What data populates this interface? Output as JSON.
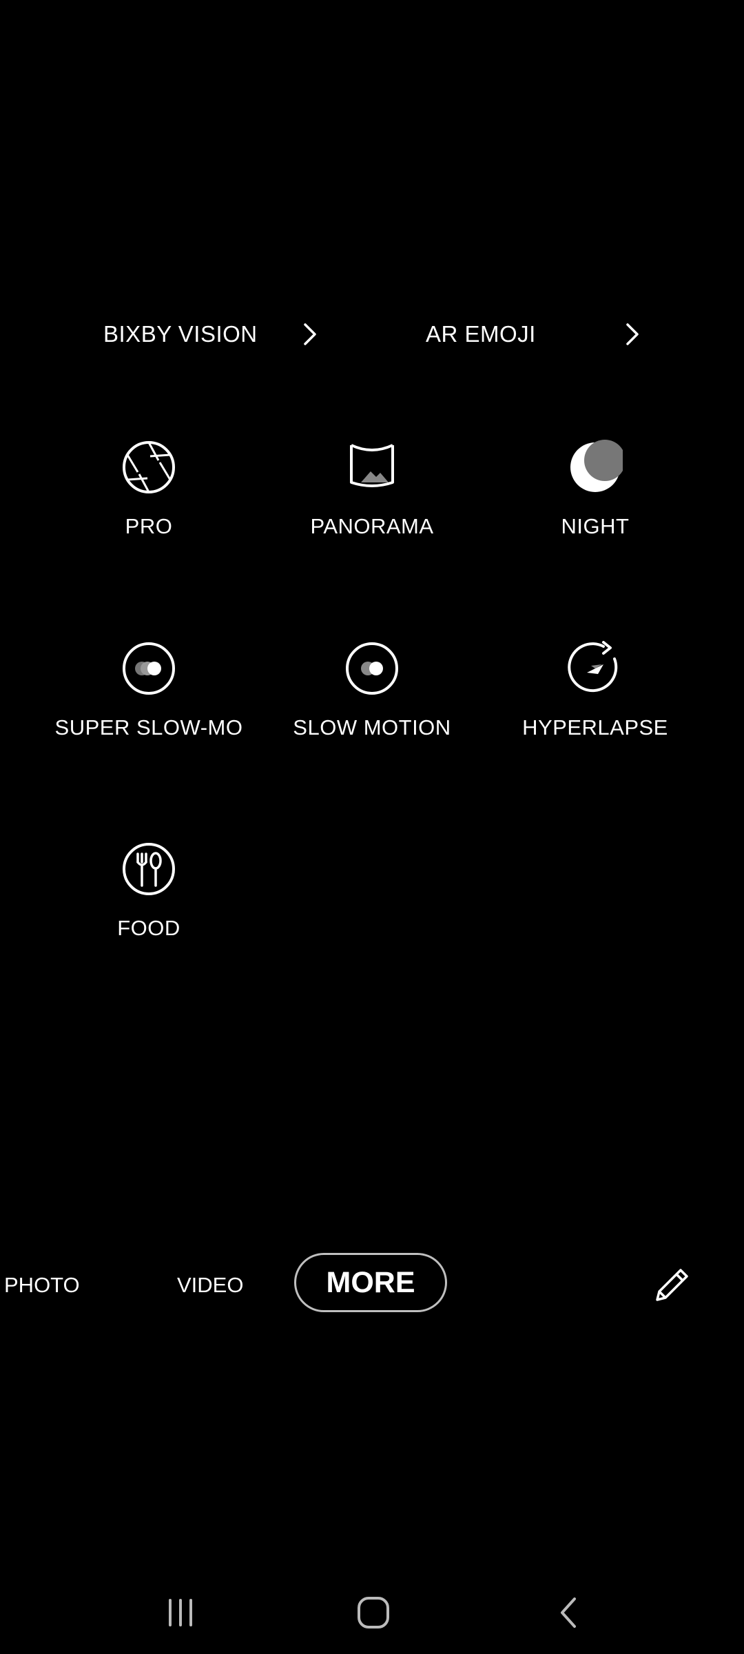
{
  "quick_links": [
    {
      "label": "BIXBY VISION",
      "icon": "chevron-right-icon"
    },
    {
      "label": "AR EMOJI",
      "icon": "chevron-right-icon"
    }
  ],
  "modes": [
    {
      "label": "PRO",
      "icon": "aperture-icon"
    },
    {
      "label": "PANORAMA",
      "icon": "panorama-icon"
    },
    {
      "label": "NIGHT",
      "icon": "moon-icon"
    },
    {
      "label": "SUPER SLOW-MO",
      "icon": "super-slow-mo-icon"
    },
    {
      "label": "SLOW MOTION",
      "icon": "slow-motion-icon"
    },
    {
      "label": "HYPERLAPSE",
      "icon": "hyperlapse-icon"
    },
    {
      "label": "FOOD",
      "icon": "food-icon"
    }
  ],
  "mode_bar": {
    "photo": "PHOTO",
    "video": "VIDEO",
    "more": "MORE",
    "edit_icon": "pencil-icon"
  },
  "nav_bar": {
    "recents_icon": "recent-apps-icon",
    "home_icon": "home-icon",
    "back_icon": "back-icon"
  },
  "colors": {
    "background": "#000000",
    "text": "#ffffff",
    "pill_border": "#bfbfbf"
  }
}
